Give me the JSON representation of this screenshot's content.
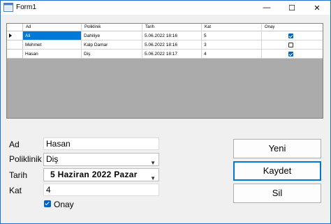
{
  "window": {
    "title": "Form1",
    "minimize_glyph": "—",
    "maximize_glyph": "☐",
    "close_glyph": "✕"
  },
  "grid": {
    "columns": [
      "Ad",
      "Poliklinik",
      "Tarih",
      "Kat",
      "Onay"
    ],
    "rows": [
      {
        "ad": "Ali",
        "poliklinik": "Dahiliye",
        "tarih": "5.06.2022 18:16",
        "kat": "5",
        "onay": true
      },
      {
        "ad": "Mehmet",
        "poliklinik": "Kalp Damar",
        "tarih": "5.06.2022 18:16",
        "kat": "3",
        "onay": false
      },
      {
        "ad": "Hasan",
        "poliklinik": "Diş",
        "tarih": "5.06.2022 18:17",
        "kat": "4",
        "onay": true
      }
    ]
  },
  "form": {
    "ad_label": "Ad",
    "ad_value": "Hasan",
    "poliklinik_label": "Poliklinik",
    "poliklinik_value": "Diş",
    "tarih_label": "Tarih",
    "tarih_value": "5  Haziran  2022      Pazar",
    "kat_label": "Kat",
    "kat_value": "4",
    "onay_label": "Onay"
  },
  "buttons": {
    "yeni": "Yeni",
    "kaydet": "Kaydet",
    "sil": "Sil"
  },
  "colors": {
    "selection": "#0078d7",
    "checkbox": "#0063c6",
    "grid_background": "#ababab"
  }
}
